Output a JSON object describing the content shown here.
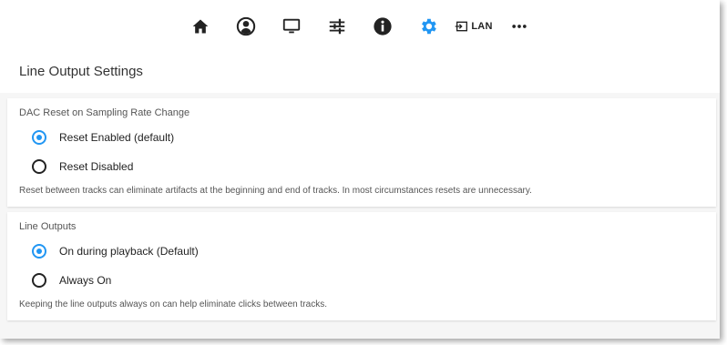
{
  "toolbar": {
    "items": [
      {
        "icon": "home-icon"
      },
      {
        "icon": "user-icon"
      },
      {
        "icon": "monitor-icon"
      },
      {
        "icon": "sliders-icon"
      },
      {
        "icon": "info-icon"
      },
      {
        "icon": "gear-icon",
        "active": true
      },
      {
        "icon": "input-icon",
        "label": "LAN"
      },
      {
        "icon": "more-icon"
      }
    ],
    "lan_label": "LAN"
  },
  "page": {
    "title": "Line Output Settings"
  },
  "accent_color": "#2196f3",
  "sections": [
    {
      "title": "DAC Reset on Sampling Rate Change",
      "options": [
        {
          "label": "Reset Enabled (default)",
          "checked": true
        },
        {
          "label": "Reset Disabled",
          "checked": false
        }
      ],
      "help": "Reset between tracks can eliminate artifacts at the beginning and end of tracks. In most circumstances resets are unnecessary."
    },
    {
      "title": "Line Outputs",
      "options": [
        {
          "label": "On during playback (Default)",
          "checked": true
        },
        {
          "label": "Always On",
          "checked": false
        }
      ],
      "help": "Keeping the line outputs always on can help eliminate clicks between tracks."
    }
  ]
}
